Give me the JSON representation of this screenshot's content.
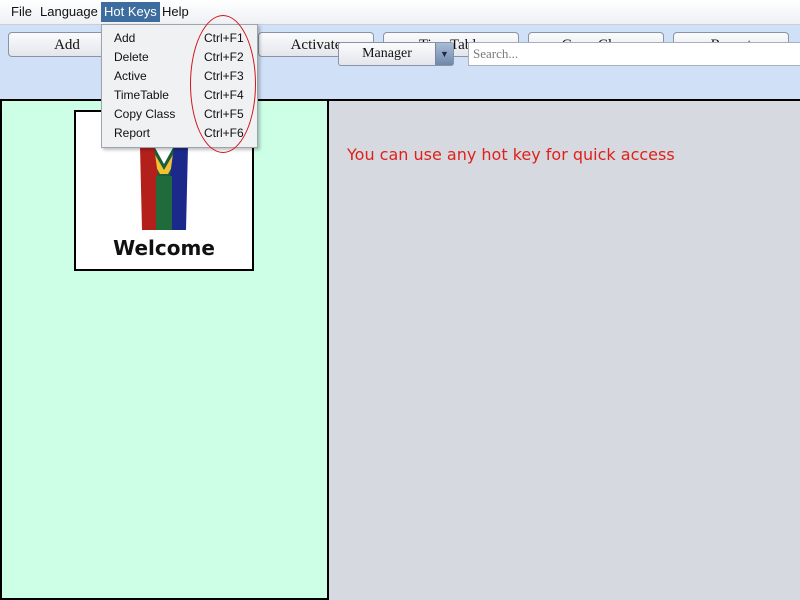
{
  "menubar": {
    "items": [
      {
        "label": "File"
      },
      {
        "label": "Language"
      },
      {
        "label": "Hot Keys"
      },
      {
        "label": "Help"
      }
    ]
  },
  "toolbar": {
    "buttons": [
      {
        "label": "Add"
      },
      {
        "label": "Activate"
      },
      {
        "label": "TimeTable"
      },
      {
        "label": "Copy Class"
      },
      {
        "label": "Report"
      }
    ],
    "role_select": {
      "value": "Manager"
    },
    "search": {
      "placeholder": "Search..."
    }
  },
  "hotkeys_menu": {
    "items": [
      {
        "label": "Add",
        "shortcut": "Ctrl+F1"
      },
      {
        "label": "Delete",
        "shortcut": "Ctrl+F2"
      },
      {
        "label": "Active",
        "shortcut": "Ctrl+F3"
      },
      {
        "label": "TimeTable",
        "shortcut": "Ctrl+F4"
      },
      {
        "label": "Copy Class",
        "shortcut": "Ctrl+F5"
      },
      {
        "label": "Report",
        "shortcut": "Ctrl+F6"
      }
    ]
  },
  "welcome": {
    "text": "Welcome"
  },
  "main": {
    "info_text": "You can use any hot key for quick access"
  },
  "colors": {
    "annotation_red": "#e0201b",
    "left_panel": "#ccffe6",
    "toolbar_bg": "#cfe0f7",
    "menu_highlight": "#3d6c9e"
  }
}
